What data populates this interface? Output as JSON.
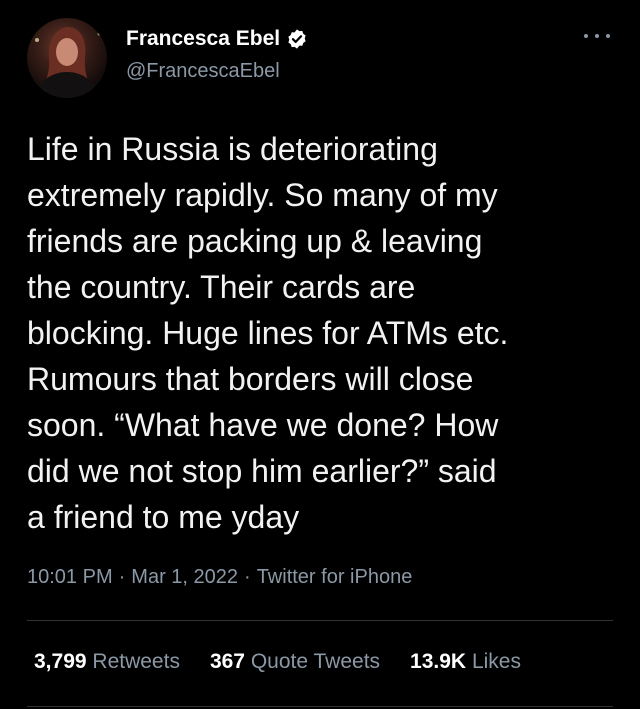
{
  "author": {
    "display_name": "Francesca Ebel",
    "handle": "@FrancescaEbel",
    "verified": true,
    "verified_color": "#ffffff",
    "avatar_icon": "profile-photo"
  },
  "tweet": {
    "text": "Life in Russia is deteriorating\nextremely rapidly. So many of my\nfriends are packing up & leaving\nthe country. Their cards are\nblocking. Huge lines for ATMs etc.\nRumours that borders will close\nsoon. “What have we done? How\ndid we not stop him earlier?” said\na friend to me yday",
    "time": "10:01 PM",
    "separator": "·",
    "date": "Mar 1, 2022",
    "source": "Twitter for iPhone"
  },
  "stats": {
    "retweets_count": "3,799",
    "retweets_label": "Retweets",
    "quotes_count": "367",
    "quotes_label": "Quote Tweets",
    "likes_count": "13.9K",
    "likes_label": "Likes"
  },
  "colors": {
    "background": "#000000",
    "text": "#e7e9ea",
    "muted": "#8b98a5",
    "divider": "#2f3336"
  }
}
